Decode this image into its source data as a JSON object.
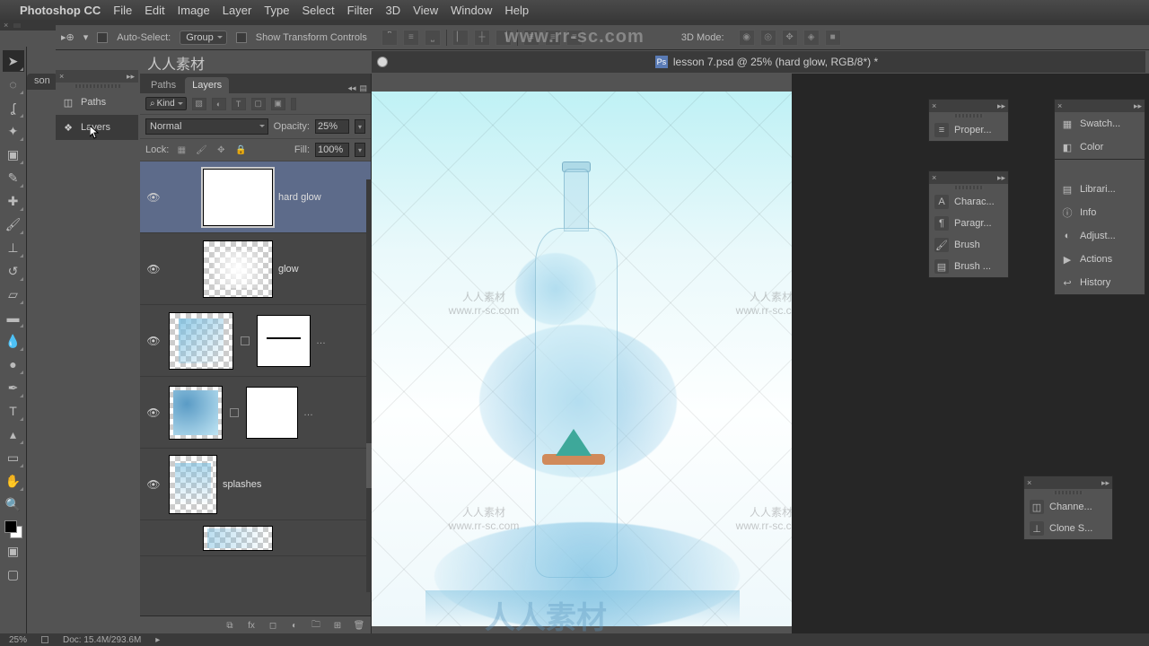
{
  "menubar": {
    "app": "Photoshop CC",
    "items": [
      "File",
      "Edit",
      "Image",
      "Layer",
      "Type",
      "Select",
      "Filter",
      "3D",
      "View",
      "Window",
      "Help"
    ]
  },
  "options_bar": {
    "auto_select": "Auto-Select:",
    "group": "Group",
    "show_transform": "Show Transform Controls",
    "mode_label": "3D Mode:"
  },
  "watermark_url": "www.rr-sc.com",
  "watermark_chars": "人人素材",
  "big_wm": "人人素材",
  "doc_tab_left": "son",
  "mini_dock": {
    "paths": "Paths",
    "layers": "Layers"
  },
  "canvas_tab": {
    "title": "lesson 7.psd @ 25% (hard glow, RGB/8*) *"
  },
  "layers_panel": {
    "tabs": [
      "Paths",
      "Layers"
    ],
    "kind": "Kind",
    "blend": "Normal",
    "opacity_label": "Opacity:",
    "opacity": "25%",
    "lock_label": "Lock:",
    "fill_label": "Fill:",
    "fill": "100%",
    "layers": [
      {
        "name": "hard glow",
        "selected": true,
        "thumb": "white"
      },
      {
        "name": "glow",
        "selected": false,
        "thumb": "checker"
      },
      {
        "name": "",
        "selected": false,
        "thumb": "checker",
        "mask": true
      },
      {
        "name": "",
        "selected": false,
        "thumb": "checker",
        "mask": true
      },
      {
        "name": "splashes",
        "selected": false,
        "thumb": "checker"
      },
      {
        "name": "",
        "selected": false,
        "thumb": "checker"
      }
    ]
  },
  "panels": {
    "fp1": [
      "Proper..."
    ],
    "fp2": [
      "Charac...",
      "Paragr...",
      "Brush",
      "Brush ..."
    ],
    "fp3": [
      "Channe...",
      "Clone S..."
    ],
    "right": [
      "Swatch...",
      "Color",
      "Librari...",
      "Info",
      "Adjust...",
      "Actions",
      "History"
    ]
  },
  "status": {
    "zoom": "25%",
    "doc": "Doc: 15.4M/293.6M"
  }
}
